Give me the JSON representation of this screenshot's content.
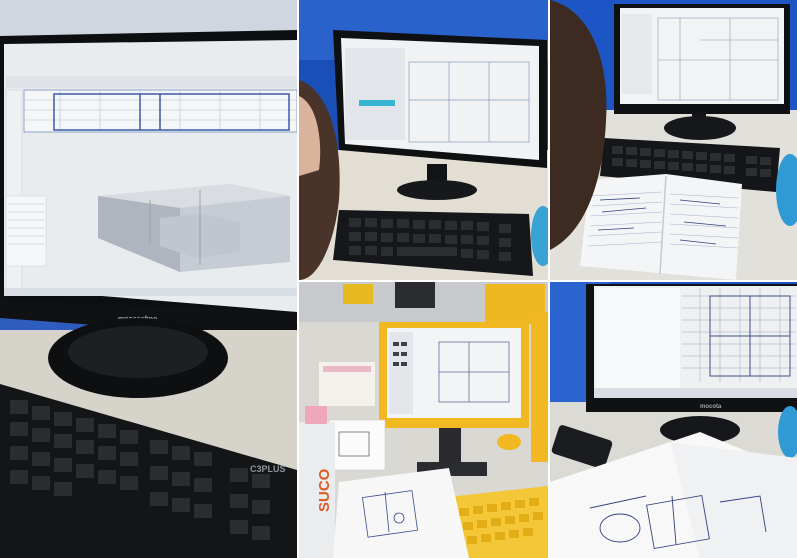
{
  "collage": {
    "panels": [
      {
        "id": "panel-1",
        "scene": "monitor-3d-floorplan",
        "monitor_brand": "mnoccafmo",
        "keyboard_brand": "C3PLUS"
      },
      {
        "id": "panel-2",
        "scene": "monitor-from-behind-student"
      },
      {
        "id": "panel-3",
        "scene": "monitor-and-notebook"
      },
      {
        "id": "panel-4",
        "scene": "yellow-monitor-and-sketches",
        "bottle_label": "SUCO"
      },
      {
        "id": "panel-5",
        "scene": "monitor-and-sketch-paper",
        "monitor_brand": "mocota"
      }
    ],
    "colors": {
      "blue_curtain": "#1b4fb8",
      "screen_white": "#eef1f2",
      "plan_line": "#3c5aa8",
      "keyboard_black": "#141517",
      "yellow_case": "#f2b821",
      "desk": "#e7e4dc"
    }
  }
}
